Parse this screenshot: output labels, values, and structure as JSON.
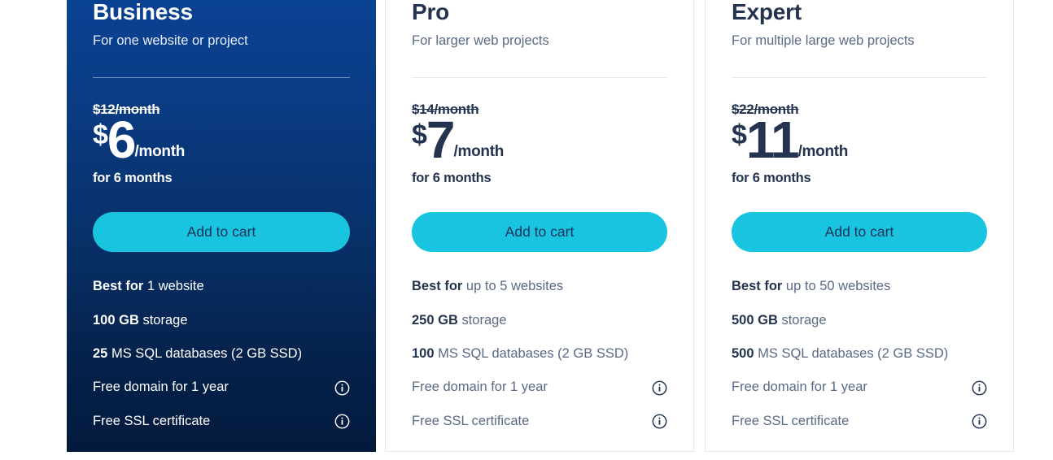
{
  "colors": {
    "page_background": "#ffffff",
    "featured_card_gradient_top": "#0a4496",
    "featured_card_gradient_bottom": "#031a3d",
    "cta_button": "#18c4e0",
    "cta_button_text": "#1d3356",
    "plain_card_border": "#e6e8ec",
    "heading_text": "#24334f",
    "muted_text": "#5a6a85"
  },
  "plans": [
    {
      "id": "business",
      "highlighted": true,
      "title": "Business",
      "subtitle": "For one website or project",
      "price": {
        "old": "$12/month",
        "currency": "$",
        "value": "6",
        "period": "/month",
        "term": "for 6 months"
      },
      "cta_label": "Add to cart",
      "features": [
        {
          "strong": "Best for",
          "rest": " 1 website",
          "info": false,
          "info_icon": "info-circle-icon"
        },
        {
          "strong": "100 GB",
          "rest": " storage",
          "info": false,
          "info_icon": "info-circle-icon"
        },
        {
          "strong": "25",
          "rest": " MS SQL databases (2 GB SSD)",
          "info": false,
          "info_icon": "info-circle-icon"
        },
        {
          "strong": "",
          "rest": "Free domain for 1 year",
          "info": true,
          "info_icon": "info-circle-icon"
        },
        {
          "strong": "",
          "rest": "Free SSL certificate",
          "info": true,
          "info_icon": "info-circle-icon"
        }
      ]
    },
    {
      "id": "pro",
      "highlighted": false,
      "title": "Pro",
      "subtitle": "For larger web projects",
      "price": {
        "old": "$14/month",
        "currency": "$",
        "value": "7",
        "period": "/month",
        "term": "for 6 months"
      },
      "cta_label": "Add to cart",
      "features": [
        {
          "strong": "Best for",
          "rest": " up to 5 websites",
          "info": false,
          "info_icon": "info-circle-icon"
        },
        {
          "strong": "250 GB",
          "rest": " storage",
          "info": false,
          "info_icon": "info-circle-icon"
        },
        {
          "strong": "100",
          "rest": " MS SQL databases (2 GB SSD)",
          "info": false,
          "info_icon": "info-circle-icon"
        },
        {
          "strong": "",
          "rest": "Free domain for 1 year",
          "info": true,
          "info_icon": "info-circle-icon"
        },
        {
          "strong": "",
          "rest": "Free SSL certificate",
          "info": true,
          "info_icon": "info-circle-icon"
        }
      ]
    },
    {
      "id": "expert",
      "highlighted": false,
      "title": "Expert",
      "subtitle": "For multiple large web projects",
      "price": {
        "old": "$22/month",
        "currency": "$",
        "value": "11",
        "period": "/month",
        "term": "for 6 months"
      },
      "cta_label": "Add to cart",
      "features": [
        {
          "strong": "Best for",
          "rest": " up to 50 websites",
          "info": false,
          "info_icon": "info-circle-icon"
        },
        {
          "strong": "500 GB",
          "rest": " storage",
          "info": false,
          "info_icon": "info-circle-icon"
        },
        {
          "strong": "500",
          "rest": " MS SQL databases (2 GB SSD)",
          "info": false,
          "info_icon": "info-circle-icon"
        },
        {
          "strong": "",
          "rest": "Free domain for 1 year",
          "info": true,
          "info_icon": "info-circle-icon"
        },
        {
          "strong": "",
          "rest": "Free SSL certificate",
          "info": true,
          "info_icon": "info-circle-icon"
        }
      ]
    }
  ]
}
